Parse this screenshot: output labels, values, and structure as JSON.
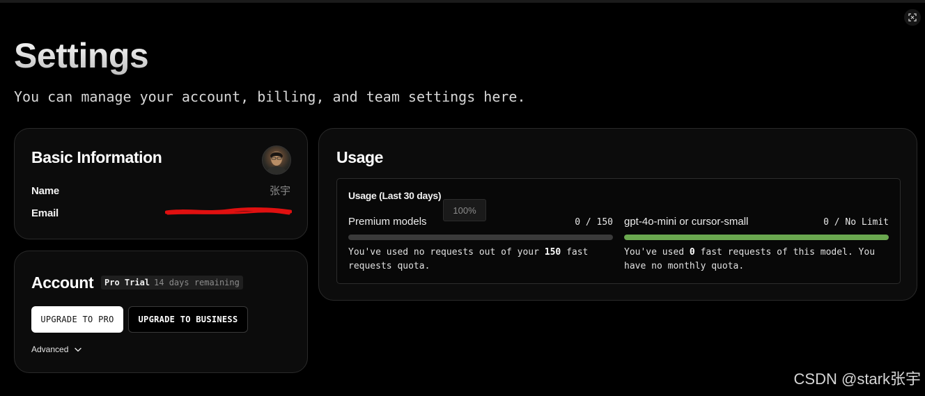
{
  "page": {
    "title": "Settings",
    "subtitle": "You can manage your account, billing, and team settings here."
  },
  "toolbar": {
    "expand_icon": "expand-icon"
  },
  "basic_info": {
    "title": "Basic Information",
    "avatar_icon": "user-avatar",
    "name_label": "Name",
    "name_value": "张宇",
    "email_label": "Email",
    "email_redaction_color": "#e01010"
  },
  "account": {
    "title": "Account",
    "plan_name": "Pro Trial",
    "plan_remaining": "14 days remaining",
    "upgrade_pro_label": "UPGRADE TO PRO",
    "upgrade_business_label": "UPGRADE TO BUSINESS",
    "advanced_label": "Advanced",
    "advanced_icon": "chevron-down-icon"
  },
  "usage": {
    "title": "Usage",
    "panel_title": "Usage (Last 30 days)",
    "tooltip": "100%",
    "models": [
      {
        "name": "Premium models",
        "count": "0 / 150",
        "used_fraction": 0,
        "bar_color": "#3a3a3a",
        "desc_prefix": "You've used no requests out of your ",
        "desc_bold": "150",
        "desc_suffix": " fast requests quota."
      },
      {
        "name": "gpt-4o-mini or cursor-small",
        "count": "0 / No Limit",
        "used_fraction": 1,
        "bar_color": "#6aa84f",
        "desc_prefix": "You've used ",
        "desc_bold": "0",
        "desc_suffix": " fast requests of this model. You have no monthly quota."
      }
    ]
  },
  "watermark": "CSDN @stark张宇"
}
